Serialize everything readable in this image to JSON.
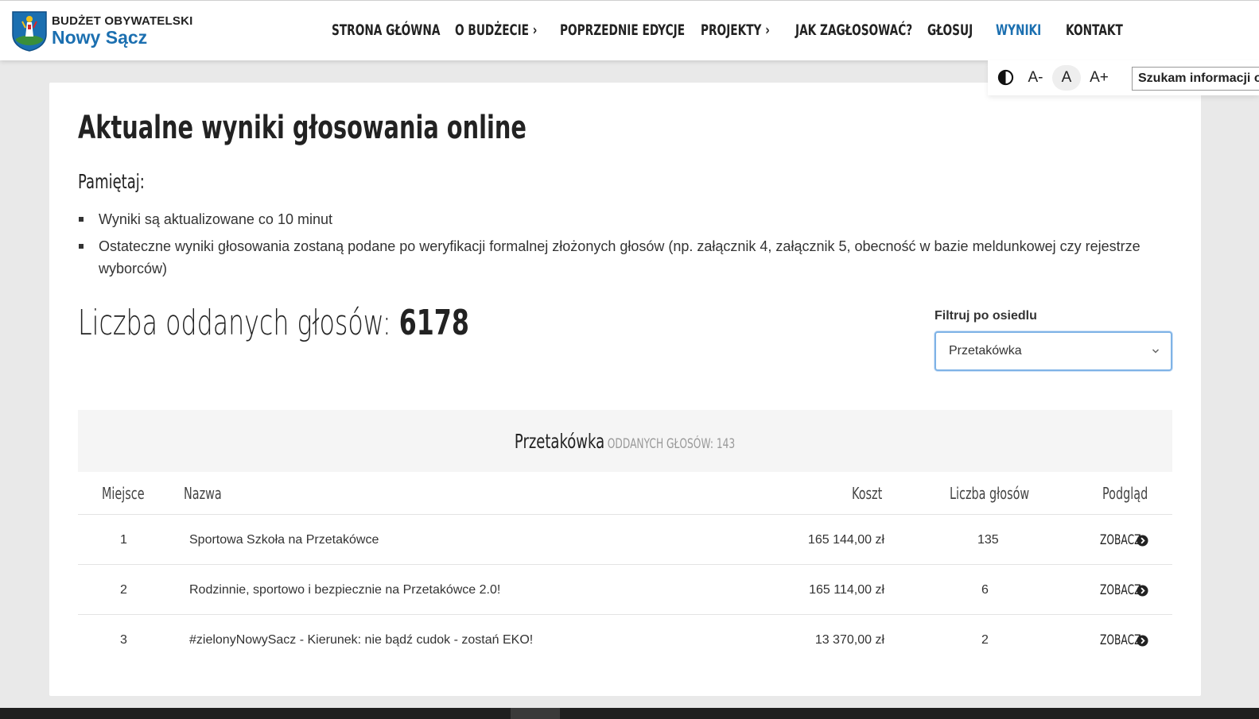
{
  "brand": {
    "line1": "BUDŻET OBYWATELSKI",
    "line2": "Nowy Sącz",
    "colors": {
      "primary": "#1b6fb0",
      "accent_gold": "#f2c21b",
      "crest_green": "#3a8f3a"
    }
  },
  "nav": {
    "items": [
      {
        "label": "STRONA GŁÓWNA"
      },
      {
        "label": "O BUDŻECIE ›"
      },
      {
        "label": "POPRZEDNIE EDYCJE"
      },
      {
        "label": "PROJEKTY ›"
      },
      {
        "label": "JAK ZAGŁOSOWAĆ?"
      },
      {
        "label": "GŁOSUJ"
      },
      {
        "label": "WYNIKI",
        "active": true
      },
      {
        "label": "KONTAKT"
      }
    ]
  },
  "accessibility": {
    "contrast_icon": "contrast-icon",
    "decrease": "A-",
    "normal": "A",
    "increase": "A+",
    "search_value": "Szukam informacji o"
  },
  "page": {
    "title": "Aktualne wyniki głosowania online",
    "remember_label": "Pamiętaj:",
    "notes": [
      "Wyniki są aktualizowane co 10 minut",
      "Ostateczne wyniki głosowania zostaną podane po weryfikacji formalnej złożonych głosów (np. załącznik 4, załącznik 5, obecność w bazie meldunkowej czy rejestrze wyborców)"
    ],
    "votes_label": "Liczba oddanych głosów:",
    "votes_total": "6178"
  },
  "filter": {
    "label": "Filtruj po osiedlu",
    "selected": "Przetakówka"
  },
  "results": {
    "district": "Przetakówka",
    "district_votes": "ODDANYCH GŁOSÓW: 143",
    "columns": {
      "place": "Miejsce",
      "name": "Nazwa",
      "cost": "Koszt",
      "votes": "Liczba głosów",
      "preview": "Podgląd"
    },
    "rows": [
      {
        "place": "1",
        "name": "Sportowa Szkoła na Przetakówce",
        "cost": "165 144,00 zł",
        "votes": "135",
        "link": "ZOBACZ"
      },
      {
        "place": "2",
        "name": "Rodzinnie, sportowo i bezpiecznie na Przetakówce 2.0!",
        "cost": "165 114,00 zł",
        "votes": "6",
        "link": "ZOBACZ"
      },
      {
        "place": "3",
        "name": "#zielonyNowySacz - Kierunek: nie bądź cudok - zostań EKO!",
        "cost": "13 370,00 zł",
        "votes": "2",
        "link": "ZOBACZ"
      }
    ]
  }
}
